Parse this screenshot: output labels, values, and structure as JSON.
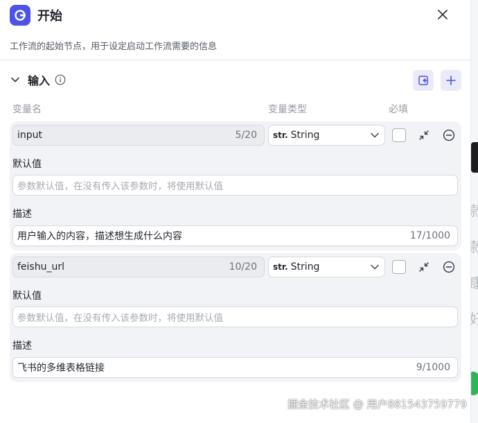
{
  "header": {
    "title": "开始",
    "description": "工作流的起始节点，用于设定启动工作流需要的信息"
  },
  "section": {
    "title": "输入"
  },
  "columns": {
    "name": "变量名",
    "type": "变量类型",
    "required": "必填"
  },
  "labels": {
    "default": "默认值",
    "description": "描述"
  },
  "variables": [
    {
      "name": "input",
      "name_count": "5/20",
      "type_tag": "str.",
      "type": "String",
      "default_placeholder": "参数默认值，在没有传入该参数时，将使用默认值",
      "description": "用户输入的内容，描述想生成什么内容",
      "description_count": "17/1000"
    },
    {
      "name": "feishu_url",
      "name_count": "10/20",
      "type_tag": "str.",
      "type": "String",
      "default_placeholder": "参数默认值，在没有传入该参数时，将使用默认值",
      "description": "飞书的多维表格链接",
      "description_count": "9/1000"
    }
  ],
  "background_glyphs": [
    "款",
    "款",
    "康",
    "好"
  ],
  "watermark": "掘金技术社区 @ 用户881543759779",
  "colors": {
    "accent": "#4d53e8",
    "card_bg": "#f2f3f6",
    "icon_btn_bg": "#eaeaf9"
  }
}
